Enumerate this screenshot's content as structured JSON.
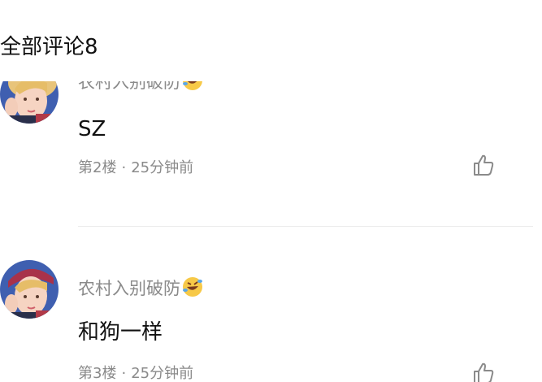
{
  "header": {
    "title": "全部评论8"
  },
  "comments": [
    {
      "username": "农村入别破防",
      "username_emoji": "rolling-on-floor-laughing-emoji-icon",
      "content": "SZ",
      "floor": "第2楼",
      "dot": "·",
      "time": "25分钟前",
      "like_icon": "thumbs-up-icon"
    },
    {
      "username": "农村入别破防",
      "username_emoji": "rolling-on-floor-laughing-emoji-icon",
      "content": "和狗一样",
      "floor": "第3楼",
      "dot": "·",
      "time": "25分钟前",
      "like_icon": "thumbs-up-icon"
    }
  ],
  "colors": {
    "primary_text": "#111111",
    "secondary_text": "#8a8a8a",
    "divider": "#ececec"
  }
}
